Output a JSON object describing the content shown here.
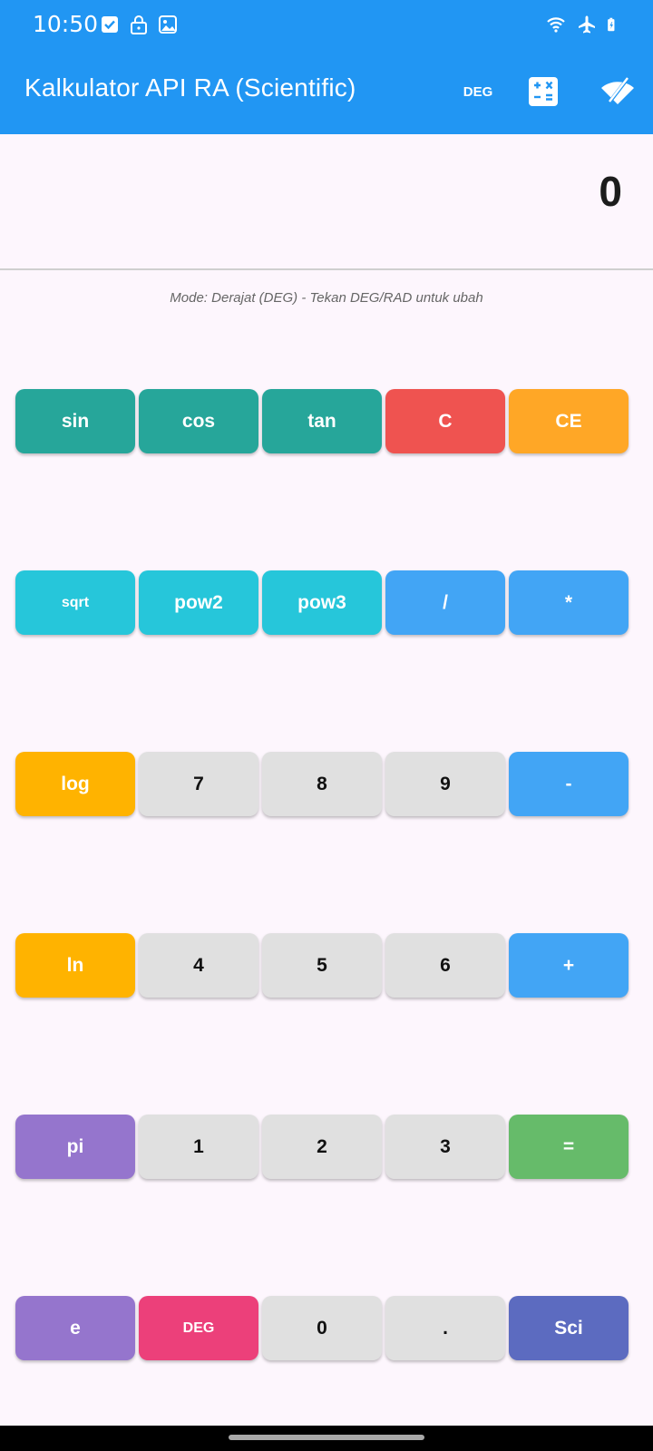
{
  "status": {
    "time": "10:50"
  },
  "appbar": {
    "title": "Kalkulator API RA (Scientific)",
    "deg_label": "DEG"
  },
  "display": {
    "value": "0"
  },
  "mode_text": "Mode: Derajat (DEG) - Tekan DEG/RAD untuk ubah",
  "colors": {
    "primary": "#2196f3",
    "trig": "#26a69a",
    "clear": "#ef5350",
    "clear_entry": "#ffa726",
    "cyan": "#26c6da",
    "operator": "#42a5f5",
    "amber": "#ffb300",
    "number": "#e0e0e0",
    "equals": "#66bb6a",
    "purple": "#9575cd",
    "pink": "#ec407a",
    "indigo": "#5c6bc0"
  },
  "rows": [
    [
      {
        "label": "sin",
        "name": "sin",
        "color": "#26a69a"
      },
      {
        "label": "cos",
        "name": "cos",
        "color": "#26a69a"
      },
      {
        "label": "tan",
        "name": "tan",
        "color": "#26a69a"
      },
      {
        "label": "C",
        "name": "clear",
        "color": "#ef5350"
      },
      {
        "label": "CE",
        "name": "clear-entry",
        "color": "#ffa726"
      }
    ],
    [
      {
        "label": "sqrt",
        "name": "sqrt",
        "color": "#26c6da",
        "small": true
      },
      {
        "label": "pow2",
        "name": "pow2",
        "color": "#26c6da"
      },
      {
        "label": "pow3",
        "name": "pow3",
        "color": "#26c6da"
      },
      {
        "label": "/",
        "name": "divide",
        "color": "#42a5f5"
      },
      {
        "label": "*",
        "name": "multiply",
        "color": "#42a5f5"
      }
    ],
    [
      {
        "label": "log",
        "name": "log",
        "color": "#ffb300"
      },
      {
        "label": "7",
        "name": "digit-7",
        "color": "#e0e0e0",
        "num": true
      },
      {
        "label": "8",
        "name": "digit-8",
        "color": "#e0e0e0",
        "num": true
      },
      {
        "label": "9",
        "name": "digit-9",
        "color": "#e0e0e0",
        "num": true
      },
      {
        "label": "-",
        "name": "subtract",
        "color": "#42a5f5"
      }
    ],
    [
      {
        "label": "ln",
        "name": "ln",
        "color": "#ffb300"
      },
      {
        "label": "4",
        "name": "digit-4",
        "color": "#e0e0e0",
        "num": true
      },
      {
        "label": "5",
        "name": "digit-5",
        "color": "#e0e0e0",
        "num": true
      },
      {
        "label": "6",
        "name": "digit-6",
        "color": "#e0e0e0",
        "num": true
      },
      {
        "label": "+",
        "name": "add",
        "color": "#42a5f5"
      }
    ],
    [
      {
        "label": "pi",
        "name": "pi",
        "color": "#9575cd"
      },
      {
        "label": "1",
        "name": "digit-1",
        "color": "#e0e0e0",
        "num": true
      },
      {
        "label": "2",
        "name": "digit-2",
        "color": "#e0e0e0",
        "num": true
      },
      {
        "label": "3",
        "name": "digit-3",
        "color": "#e0e0e0",
        "num": true
      },
      {
        "label": "=",
        "name": "equals",
        "color": "#66bb6a"
      }
    ],
    [
      {
        "label": "e",
        "name": "euler",
        "color": "#9575cd"
      },
      {
        "label": "DEG",
        "name": "deg-rad-toggle",
        "color": "#ec407a",
        "small": true
      },
      {
        "label": "0",
        "name": "digit-0",
        "color": "#e0e0e0",
        "num": true
      },
      {
        "label": ".",
        "name": "decimal",
        "color": "#e0e0e0",
        "num": true
      },
      {
        "label": "Sci",
        "name": "scientific-mode",
        "color": "#5c6bc0"
      }
    ]
  ]
}
